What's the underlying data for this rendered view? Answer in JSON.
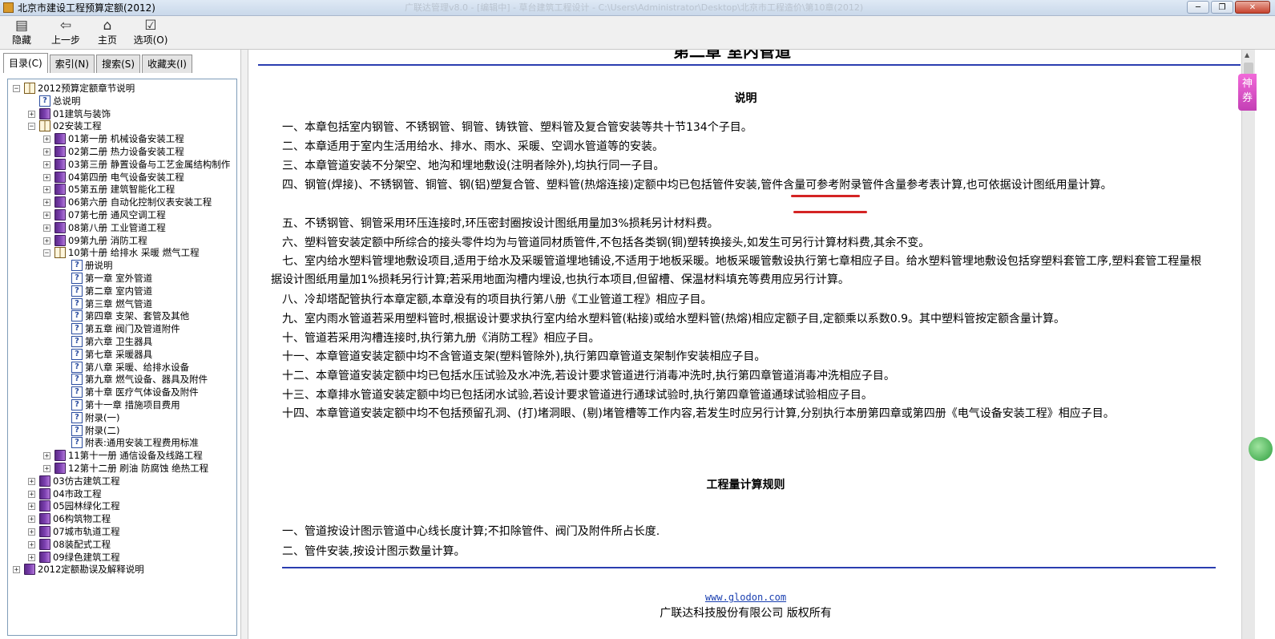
{
  "window": {
    "title": "北京市建设工程预算定额(2012)",
    "faded_title": "广联达管理v8.0  -  [编辑中]  -  草台建筑工程设计  -  C:\\Users\\Administrator\\Desktop\\北京市工程造价\\第10章(2012)",
    "btn_min": "─",
    "btn_max": "❐",
    "btn_close": "✕"
  },
  "toolbar": {
    "hide": "隐藏",
    "back": "上一步",
    "home": "主页",
    "options": "选项(O)"
  },
  "tabs": [
    {
      "label": "目录(C)",
      "active": true
    },
    {
      "label": "索引(N)",
      "active": false
    },
    {
      "label": "搜索(S)",
      "active": false
    },
    {
      "label": "收藏夹(I)",
      "active": false
    }
  ],
  "tree": [
    {
      "label": "2012预算定额章节说明",
      "level": 0,
      "icon": "bookopen",
      "toggle": "-"
    },
    {
      "label": "总说明",
      "level": 1,
      "icon": "help",
      "toggle": ""
    },
    {
      "label": "01建筑与装饰",
      "level": 1,
      "icon": "bookclosed",
      "toggle": "+"
    },
    {
      "label": "02安装工程",
      "level": 1,
      "icon": "bookopen",
      "toggle": "-"
    },
    {
      "label": "01第一册 机械设备安装工程",
      "level": 2,
      "icon": "bookclosed",
      "toggle": "+"
    },
    {
      "label": "02第二册 热力设备安装工程",
      "level": 2,
      "icon": "bookclosed",
      "toggle": "+"
    },
    {
      "label": "03第三册 静置设备与工艺金属结构制作",
      "level": 2,
      "icon": "bookclosed",
      "toggle": "+"
    },
    {
      "label": "04第四册 电气设备安装工程",
      "level": 2,
      "icon": "bookclosed",
      "toggle": "+"
    },
    {
      "label": "05第五册 建筑智能化工程",
      "level": 2,
      "icon": "bookclosed",
      "toggle": "+"
    },
    {
      "label": "06第六册 自动化控制仪表安装工程",
      "level": 2,
      "icon": "bookclosed",
      "toggle": "+"
    },
    {
      "label": "07第七册 通风空调工程",
      "level": 2,
      "icon": "bookclosed",
      "toggle": "+"
    },
    {
      "label": "08第八册 工业管道工程",
      "level": 2,
      "icon": "bookclosed",
      "toggle": "+"
    },
    {
      "label": "09第九册 消防工程",
      "level": 2,
      "icon": "bookclosed",
      "toggle": "+"
    },
    {
      "label": "10第十册 给排水 采暖 燃气工程",
      "level": 2,
      "icon": "bookopen",
      "toggle": "-"
    },
    {
      "label": "册说明",
      "level": 3,
      "icon": "help",
      "toggle": ""
    },
    {
      "label": "第一章 室外管道",
      "level": 3,
      "icon": "help",
      "toggle": ""
    },
    {
      "label": "第二章 室内管道",
      "level": 3,
      "icon": "help",
      "toggle": ""
    },
    {
      "label": "第三章 燃气管道",
      "level": 3,
      "icon": "help",
      "toggle": ""
    },
    {
      "label": "第四章 支架、套管及其他",
      "level": 3,
      "icon": "help",
      "toggle": ""
    },
    {
      "label": "第五章 阀门及管道附件",
      "level": 3,
      "icon": "help",
      "toggle": ""
    },
    {
      "label": "第六章 卫生器具",
      "level": 3,
      "icon": "help",
      "toggle": ""
    },
    {
      "label": "第七章 采暖器具",
      "level": 3,
      "icon": "help",
      "toggle": ""
    },
    {
      "label": "第八章 采暖、给排水设备",
      "level": 3,
      "icon": "help",
      "toggle": ""
    },
    {
      "label": "第九章 燃气设备、器具及附件",
      "level": 3,
      "icon": "help",
      "toggle": ""
    },
    {
      "label": "第十章 医疗气体设备及附件",
      "level": 3,
      "icon": "help",
      "toggle": ""
    },
    {
      "label": "第十一章 措施项目费用",
      "level": 3,
      "icon": "help",
      "toggle": ""
    },
    {
      "label": "附录(一)",
      "level": 3,
      "icon": "help",
      "toggle": ""
    },
    {
      "label": "附录(二)",
      "level": 3,
      "icon": "help",
      "toggle": ""
    },
    {
      "label": "附表:通用安装工程费用标准",
      "level": 3,
      "icon": "help",
      "toggle": ""
    },
    {
      "label": "11第十一册 通信设备及线路工程",
      "level": 2,
      "icon": "bookclosed",
      "toggle": "+"
    },
    {
      "label": "12第十二册 刷油 防腐蚀 绝热工程",
      "level": 2,
      "icon": "bookclosed",
      "toggle": "+"
    },
    {
      "label": "03仿古建筑工程",
      "level": 1,
      "icon": "bookclosed",
      "toggle": "+"
    },
    {
      "label": "04市政工程",
      "level": 1,
      "icon": "bookclosed",
      "toggle": "+"
    },
    {
      "label": "05园林绿化工程",
      "level": 1,
      "icon": "bookclosed",
      "toggle": "+"
    },
    {
      "label": "06构筑物工程",
      "level": 1,
      "icon": "bookclosed",
      "toggle": "+"
    },
    {
      "label": "07城市轨道工程",
      "level": 1,
      "icon": "bookclosed",
      "toggle": "+"
    },
    {
      "label": "08装配式工程",
      "level": 1,
      "icon": "bookclosed",
      "toggle": "+"
    },
    {
      "label": "09绿色建筑工程",
      "level": 1,
      "icon": "bookclosed",
      "toggle": "+"
    },
    {
      "label": "2012定额勘误及解释说明",
      "level": 0,
      "icon": "bookclosed",
      "toggle": "+"
    }
  ],
  "content": {
    "chapter_title": "第二章 室内管道",
    "section1_title": "说明",
    "paragraphs": [
      "一、本章包括室内钢管、不锈钢管、铜管、铸铁管、塑料管及复合管安装等共十节134个子目。",
      "二、本章适用于室内生活用给水、排水、雨水、采暖、空调水管道等的安装。",
      "三、本章管道安装不分架空、地沟和埋地敷设(注明者除外),均执行同一子目。",
      "四、钢管(焊接)、不锈钢管、铜管、钢(铝)塑复合管、塑料管(热熔连接)定额中均已包括管件安装,管件含量可参考附录管件含量参考表计算,也可依据设计图纸用量计算。",
      "五、不锈钢管、铜管采用环压连接时,环压密封圈按设计图纸用量加3%损耗另计材料费。",
      "六、塑料管安装定额中所综合的接头零件均为与管道同材质管件,不包括各类钢(铜)塑转换接头,如发生可另行计算材料费,其余不变。",
      "七、室内给水塑料管埋地敷设项目,适用于给水及采暖管道埋地铺设,不适用于地板采暖。地板采暖管敷设执行第七章相应子目。给水塑料管埋地敷设包括穿塑料套管工序,塑料套管工程量根据设计图纸用量加1%损耗另行计算;若采用地面沟槽内埋设,也执行本项目,但留槽、保温材料填充等费用应另行计算。",
      "八、冷却塔配管执行本章定额,本章没有的项目执行第八册《工业管道工程》相应子目。",
      "九、室内雨水管道若采用塑料管时,根据设计要求执行室内给水塑料管(粘接)或给水塑料管(热熔)相应定额子目,定额乘以系数0.9。其中塑料管按定额含量计算。",
      "十、管道若采用沟槽连接时,执行第九册《消防工程》相应子目。",
      "十一、本章管道安装定额中均不含管道支架(塑料管除外),执行第四章管道支架制作安装相应子目。",
      "十二、本章管道安装定额中均已包括水压试验及水冲洗,若设计要求管道进行消毒冲洗时,执行第四章管道消毒冲洗相应子目。",
      "十三、本章排水管道安装定额中均已包括闭水试验,若设计要求管道进行通球试验时,执行第四章管道通球试验相应子目。",
      "十四、本章管道安装定额中均不包括预留孔洞、(打)堵洞眼、(剔)堵管槽等工作内容,若发生时应另行计算,分别执行本册第四章或第四册《电气设备安装工程》相应子目。"
    ],
    "section2_title": "工程量计算规则",
    "rules": [
      "一、管道按设计图示管道中心线长度计算;不扣除管件、阀门及附件所占长度.",
      "二、管件安装,按设计图示数量计算。"
    ],
    "footer_link": "www.glodon.com",
    "footer_text": "广联达科技股份有限公司 版权所有"
  },
  "side_widget": {
    "label": "神券"
  }
}
